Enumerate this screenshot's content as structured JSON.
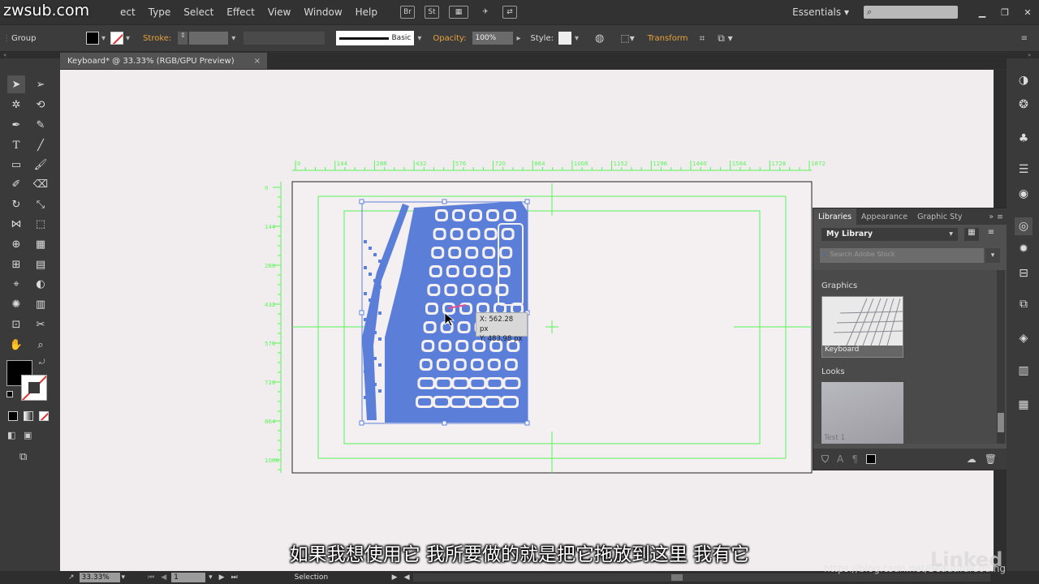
{
  "watermark": {
    "site": "zwsub.com",
    "csdn": "https://blog.csdn.net/BeautifulCoding",
    "brand": "Linked"
  },
  "menubar": {
    "items": [
      "ect",
      "Type",
      "Select",
      "Effect",
      "View",
      "Window",
      "Help"
    ],
    "icons": [
      "Br",
      "St"
    ],
    "workspace": "Essentials",
    "workspace_chevron": "▾"
  },
  "controlbar": {
    "selection_type": "Group",
    "stroke_label": "Stroke:",
    "brush_label": "Basic",
    "opacity_label": "Opacity:",
    "opacity_value": "100%",
    "style_label": "Style:",
    "transform_label": "Transform"
  },
  "document": {
    "tab_title": "Keyboard* @ 33.33% (RGB/GPU Preview)",
    "close": "×"
  },
  "rulers": {
    "h_ticks": [
      "0",
      "144",
      "288",
      "432",
      "576",
      "720",
      "864",
      "1008",
      "1152",
      "1296",
      "1440",
      "1584",
      "1728",
      "1872"
    ],
    "v_ticks": [
      "0",
      "144",
      "288",
      "432",
      "576",
      "720",
      "864",
      "1008"
    ]
  },
  "tooltip": {
    "x": "X: 562.28 px",
    "y": "Y: 483.98 px"
  },
  "libraries": {
    "tabs": [
      "Libraries",
      "Appearance",
      "Graphic Sty"
    ],
    "library_name": "My Library",
    "search_placeholder": "Search Adobe Stock",
    "graphics_label": "Graphics",
    "graphic_item": "Keyboard",
    "looks_label": "Looks",
    "look_item": "Test 1"
  },
  "statusbar": {
    "zoom": "33.33%",
    "artboard": "1",
    "mode": "Selection"
  },
  "subtitle": "如果我想使用它  我所要做的就是把它拖放到这里  我有它",
  "colors": {
    "accent_green": "#59f659",
    "selection_blue": "#5b7fd8",
    "canvas": "#f1ecee",
    "stroke_orange": "#e8a23a"
  }
}
